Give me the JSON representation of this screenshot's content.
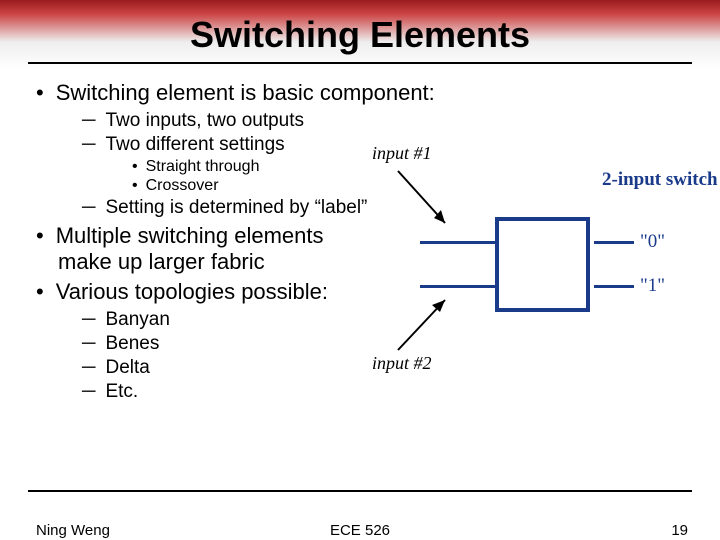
{
  "title": "Switching Elements",
  "bullets": {
    "b1": "Switching element is basic component:",
    "b1a": "Two inputs, two outputs",
    "b1b": "Two different settings",
    "b1b1": "Straight through",
    "b1b2": "Crossover",
    "b1c": "Setting is determined by “label”",
    "b2": "Multiple switching elements make up larger fabric",
    "b3": "Various topologies possible:",
    "b3a": "Banyan",
    "b3b": "Benes",
    "b3c": "Delta",
    "b3d": "Etc."
  },
  "diagram": {
    "input1": "input #1",
    "input2": "input #2",
    "switchLabel": "2-input switch",
    "out0": "\"0\"",
    "out1": "\"1\""
  },
  "footer": {
    "author": "Ning Weng",
    "course": "ECE 526",
    "page": "19"
  }
}
